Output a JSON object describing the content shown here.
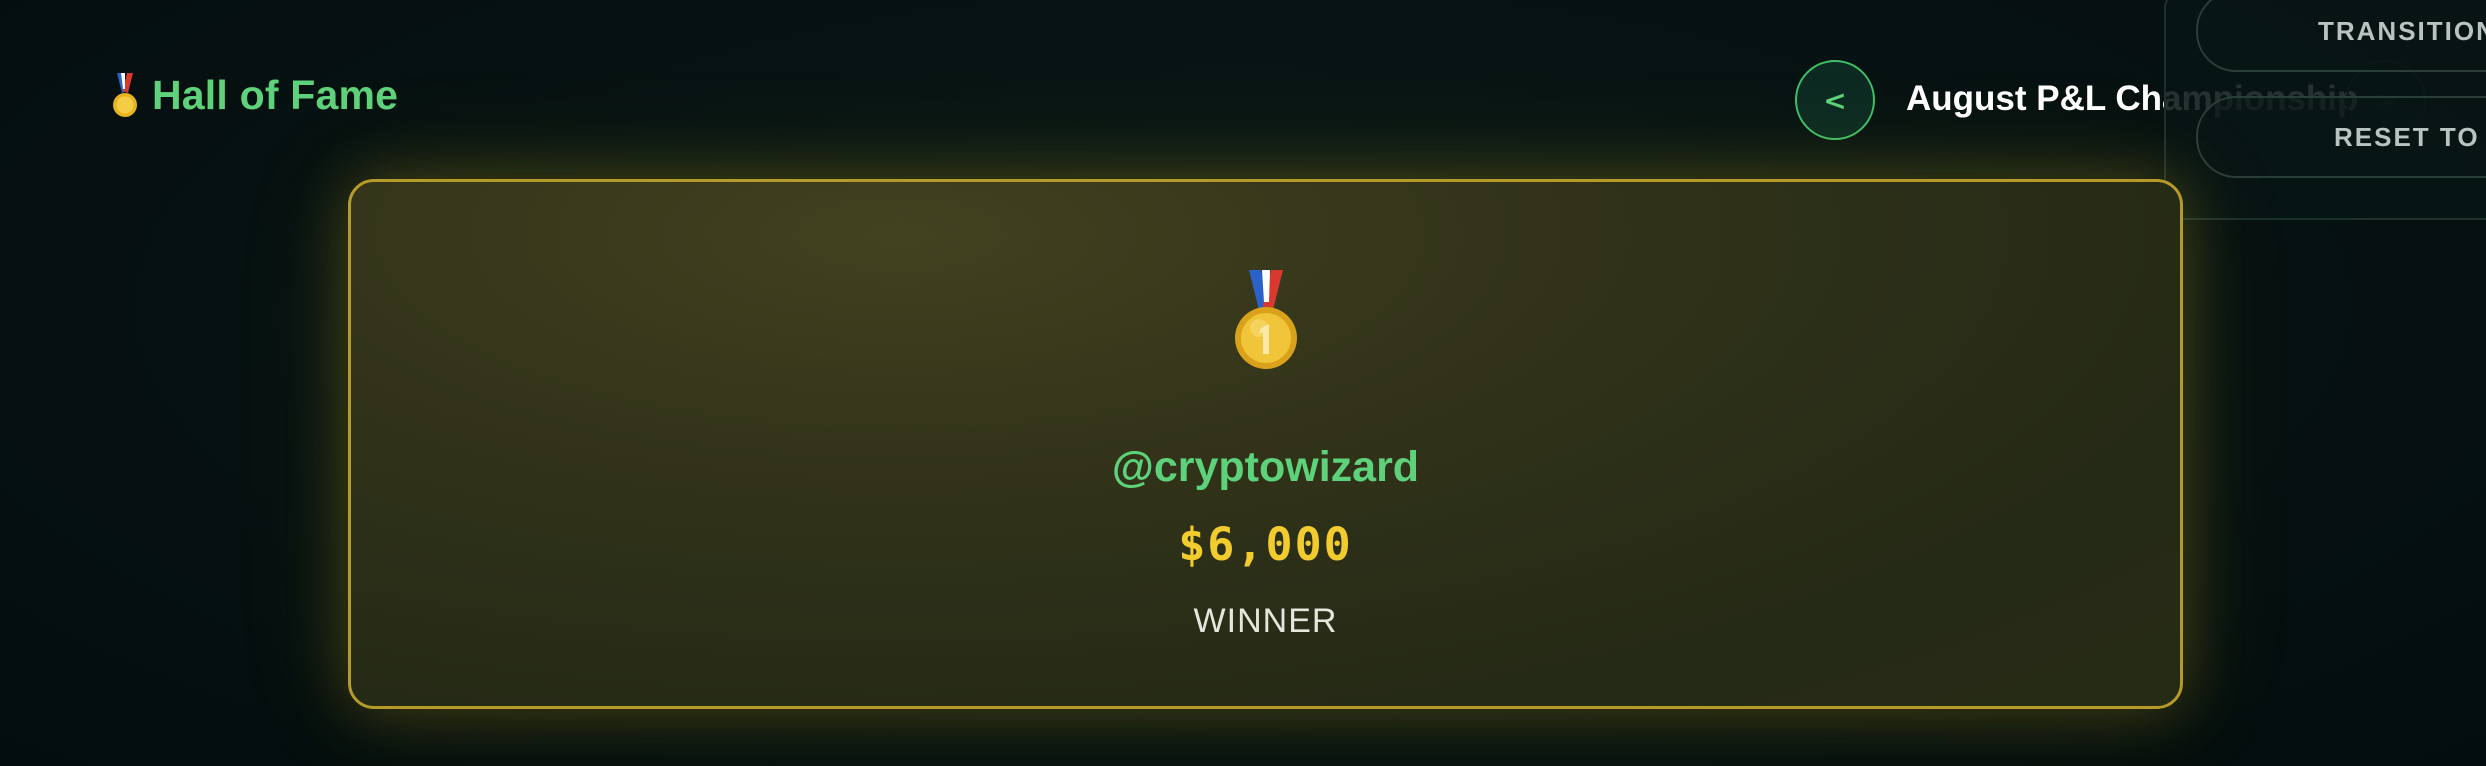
{
  "header": {
    "title": "Hall of Fame",
    "title_icon": "medal-icon"
  },
  "event_nav": {
    "prev_label": "<",
    "event_title": "August P&L Championship",
    "next_label": ">"
  },
  "overlay": {
    "transition_label": "TRANSITION",
    "reset_label": "RESET TO"
  },
  "winner_card": {
    "medal_icon": "gold-medal-icon",
    "username": "@cryptowizard",
    "amount": "$6,000",
    "label": "WINNER"
  },
  "colors": {
    "accent_green": "#5ed27a",
    "gold": "#f2cc2f",
    "card_border": "#b59a2a",
    "background": "#061212"
  }
}
